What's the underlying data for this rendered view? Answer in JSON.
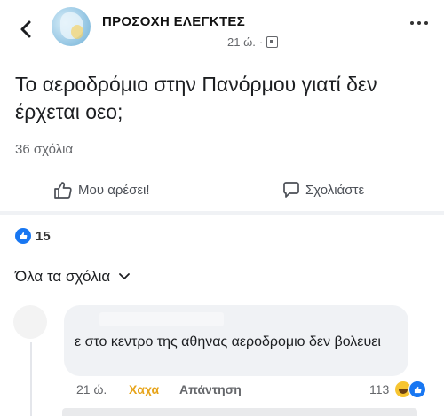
{
  "header": {
    "group_name": "ΠΡΟΣΟΧΗ ΕΛΕΓΚΤΕΣ",
    "time": "21 ώ.",
    "separator": "·",
    "back_icon": "chevron-left-icon",
    "more_icon": "more-dots-icon"
  },
  "post": {
    "text": "Το αεροδρόμιο στην Πανόρμου γιατί δεν έρχεται οεο;",
    "comments_count": "36 σχόλια"
  },
  "actions": {
    "like_label": "Μου αρέσει!",
    "comment_label": "Σχολιάστε"
  },
  "reactions": {
    "count": "15"
  },
  "comments_filter": {
    "label": "Όλα τα σχόλια"
  },
  "comment": {
    "text": "ε στο κεντρο της αθηνας αεροδρομιο δεν βολευει",
    "time": "21 ώ.",
    "reaction_label": "Χαχα",
    "reply_label": "Απάντηση",
    "reactions_count": "113"
  },
  "colors": {
    "accent": "#1877f2",
    "haha": "#e7a41a",
    "muted": "#65676b",
    "bubble": "#f0f2f5"
  }
}
